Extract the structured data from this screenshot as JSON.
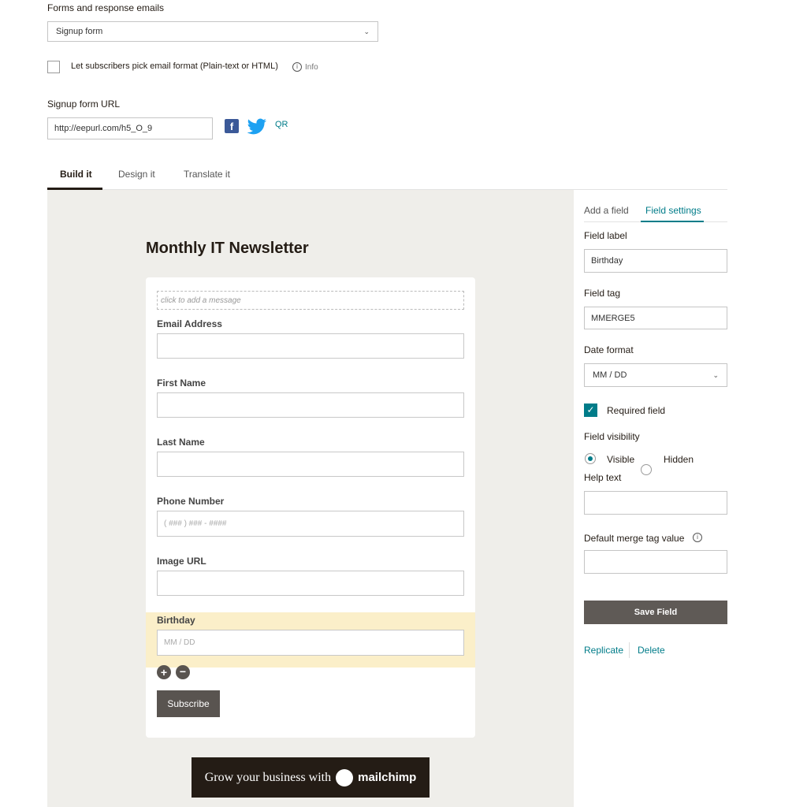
{
  "header": {
    "forms_label": "Forms and response emails",
    "form_select": "Signup form",
    "pick_format_label": "Let subscribers pick email format (Plain-text or HTML)",
    "info_label": "Info",
    "signup_url_label": "Signup form URL",
    "signup_url_value": "http://eepurl.com/h5_O_9",
    "qr_label": "QR"
  },
  "tabs": [
    {
      "label": "Build it",
      "active": true
    },
    {
      "label": "Design it",
      "active": false
    },
    {
      "label": "Translate it",
      "active": false
    }
  ],
  "form": {
    "title": "Monthly IT Newsletter",
    "message_placeholder": "click to add a message",
    "fields": [
      {
        "label": "Email Address",
        "placeholder": ""
      },
      {
        "label": "First Name",
        "placeholder": ""
      },
      {
        "label": "Last Name",
        "placeholder": ""
      },
      {
        "label": "Phone Number",
        "placeholder": "( ### ) ### - ####"
      },
      {
        "label": "Image URL",
        "placeholder": ""
      },
      {
        "label": "Birthday",
        "placeholder": "MM / DD"
      }
    ],
    "subscribe_label": "Subscribe",
    "banner_text": "Grow your business with",
    "banner_brand": "mailchimp"
  },
  "panel": {
    "tab_add": "Add a field",
    "tab_settings": "Field settings",
    "field_label_label": "Field label",
    "field_label_value": "Birthday",
    "field_tag_label": "Field tag",
    "field_tag_value": "MMERGE5",
    "date_format_label": "Date format",
    "date_format_value": "MM / DD",
    "required_label": "Required field",
    "visibility_label": "Field visibility",
    "visible_label": "Visible",
    "hidden_label": "Hidden",
    "help_text_label": "Help text",
    "default_merge_label": "Default merge tag value",
    "save_label": "Save Field",
    "replicate_label": "Replicate",
    "delete_label": "Delete"
  },
  "colors": {
    "accent": "#007c89",
    "canvas_bg": "#efeeea",
    "highlight": "#fbefc9",
    "button_dark": "#595450",
    "banner_bg": "#241c15"
  }
}
